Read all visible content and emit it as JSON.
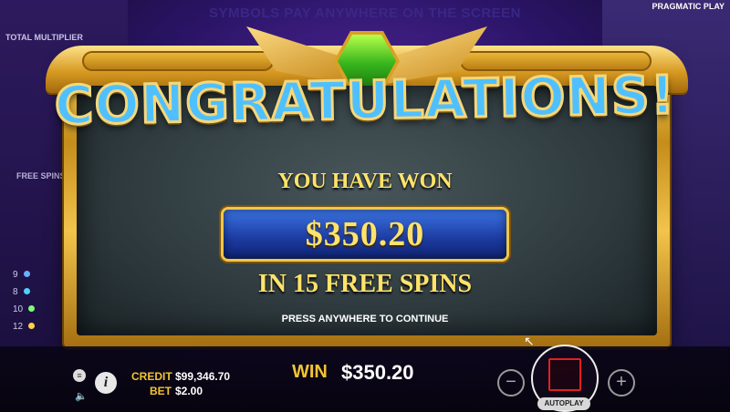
{
  "game": {
    "top_banner": "SYMBOLS PAY ANYWHERE ON THE SCREEN",
    "provider": "PRAGMATIC PLAY",
    "side_label_top": "TOTAL MULTIPLIER",
    "side_label_mid": "FREE SPINS LEFT"
  },
  "paytable": [
    {
      "count": "9",
      "color": "#6ab0ff"
    },
    {
      "count": "8",
      "color": "#4fd0ff"
    },
    {
      "count": "10",
      "color": "#7cff7c"
    },
    {
      "count": "12",
      "color": "#ffd24a"
    }
  ],
  "popup": {
    "title": "CONGRATULATIONS!",
    "subtitle": "YOU HAVE WON",
    "amount": "$350.20",
    "spins_text": "IN 15 FREE SPINS",
    "prompt": "PRESS ANYWHERE TO CONTINUE",
    "gem_color": "#37b51c"
  },
  "status": {
    "credit_label": "CREDIT",
    "credit_value": "$99,346.70",
    "bet_label": "BET",
    "bet_value": "$2.00",
    "win_label": "WIN",
    "win_value": "$350.20"
  },
  "controls": {
    "menu_icon": "≡",
    "info_icon": "i",
    "sound_icon": "🔈",
    "minus": "−",
    "plus": "+",
    "autoplay_label": "AUTOPLAY"
  }
}
